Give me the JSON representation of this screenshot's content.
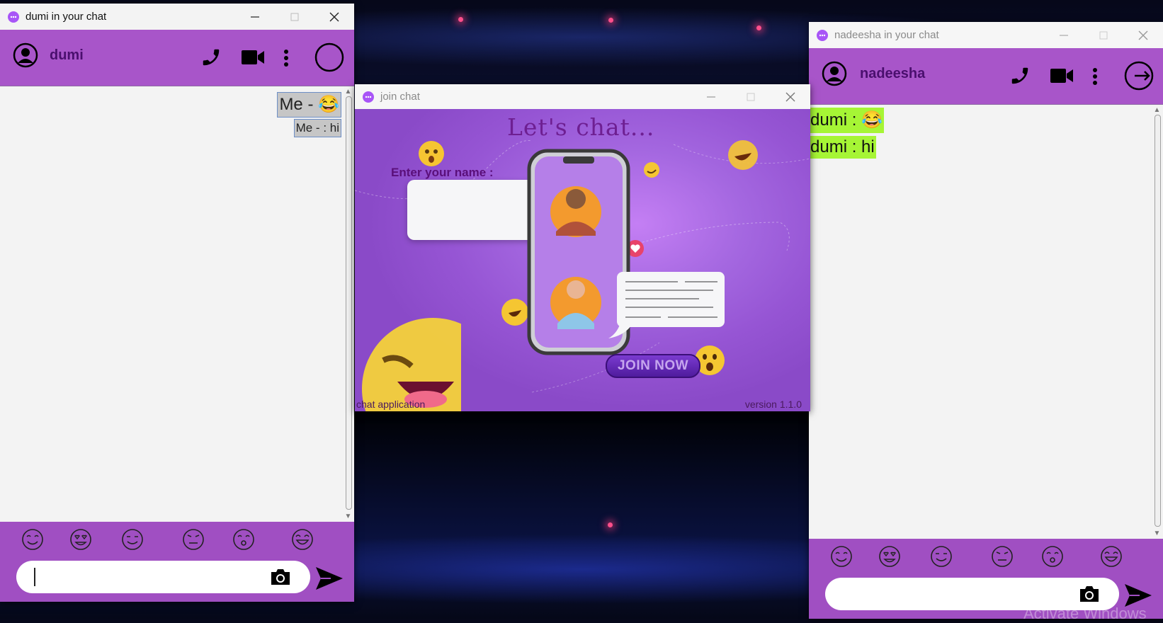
{
  "left_window": {
    "title": "dumi in your chat",
    "contact_name": "dumi",
    "messages": [
      {
        "text": "Me - 😂",
        "size": "large"
      },
      {
        "text": "Me - : hi",
        "size": "small"
      }
    ],
    "emojis": [
      "smile-emoji",
      "heart-eyes-emoji",
      "grin-emoji",
      "worried-emoji",
      "kiss-emoji",
      "laugh-emoji"
    ],
    "message_value": "",
    "colors": {
      "header": "#a855c9",
      "footer": "#a04fc2",
      "name": "#4a0f6e"
    }
  },
  "join_window": {
    "title": "join chat",
    "heading": "Let's chat...",
    "name_label": "Enter your name :",
    "name_value": "",
    "join_button": "JOIN NOW",
    "footer_left": "chat application",
    "footer_right": "version 1.1.0"
  },
  "right_window": {
    "title": "nadeesha in your chat",
    "contact_name": "nadeesha",
    "messages": [
      {
        "text": "dumi : 😂"
      },
      {
        "text": "dumi : hi"
      }
    ],
    "message_value": "",
    "colors": {
      "bubble": "#a6f535"
    }
  },
  "os": {
    "watermark": "Activate Windows"
  }
}
